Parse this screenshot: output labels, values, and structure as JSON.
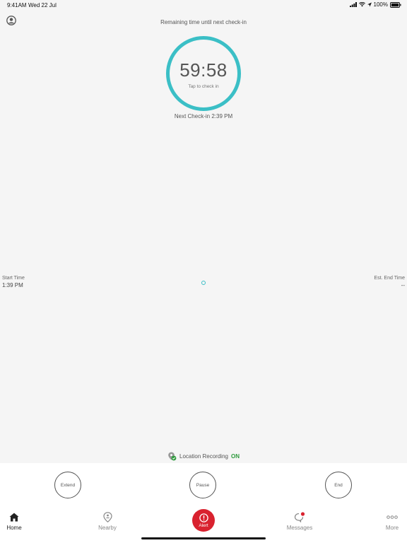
{
  "status_bar": {
    "time": "9:41AM",
    "date": "Wed 22 Jul",
    "battery": "100%"
  },
  "header": {
    "remaining_label": "Remaining time until next check-in"
  },
  "timer": {
    "countdown": "59:58",
    "tap_hint": "Tap to check in",
    "ring_color": "#3bbfc6"
  },
  "next_checkin": "Next Check-in 2:39 PM",
  "session": {
    "start_label": "Start Time",
    "start_value": "1:39 PM",
    "end_label": "Est. End Time",
    "end_value": "--"
  },
  "location": {
    "label": "Location Recording",
    "state": "ON",
    "state_color": "#2e9a3c"
  },
  "actions": {
    "extend": "Extend",
    "pause": "Pause",
    "end": "End"
  },
  "tabs": {
    "home": "Home",
    "nearby": "Nearby",
    "alert": "Alert",
    "messages": "Messages",
    "more": "More",
    "alert_color": "#d9222f"
  }
}
